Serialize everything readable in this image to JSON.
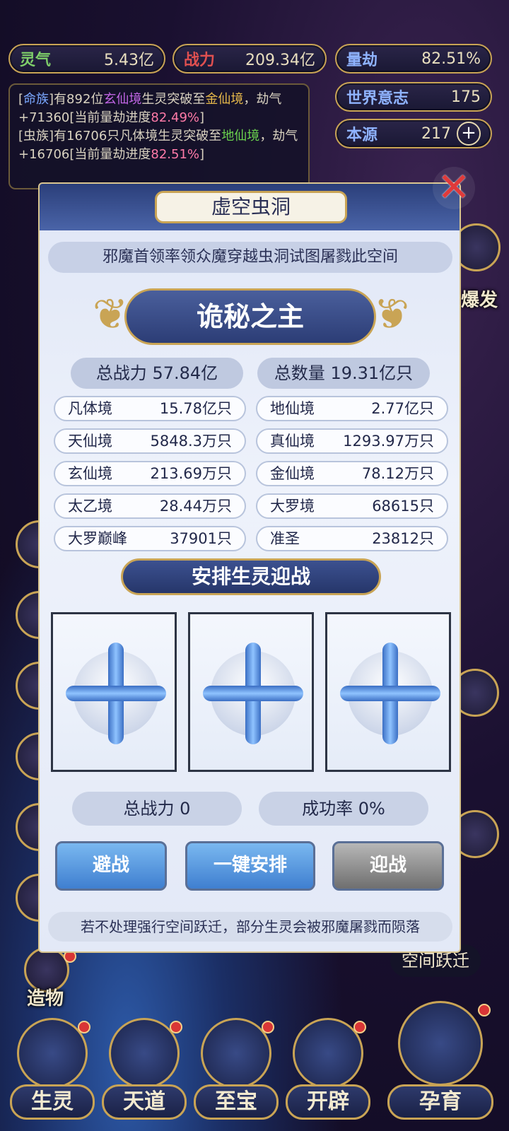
{
  "resources": {
    "lingqi": {
      "label": "灵气",
      "value": "5.43亿"
    },
    "zhanli": {
      "label": "战力",
      "value": "209.34亿"
    },
    "liangjie": {
      "label": "量劫",
      "value": "82.51%"
    },
    "shijie": {
      "label": "世界意志",
      "value": "175"
    },
    "benyuan": {
      "label": "本源",
      "value": "217",
      "plus": "+"
    }
  },
  "log": {
    "l1_a": "[",
    "l1_b": "命族",
    "l1_c": "]有892位",
    "l1_d": "玄仙境",
    "l1_e": "生灵突破至",
    "l1_f": "金仙境",
    "l1_g": "，劫气+71360[当前量劫进度",
    "l1_h": "82.49%",
    "l1_i": "]",
    "l2_a": "[虫族]有16706只凡体境生灵突破至",
    "l2_b": "地仙境",
    "l2_c": "，劫气+16706[当前量劫进度",
    "l2_d": "82.51%",
    "l2_e": "]"
  },
  "side": {
    "burst": "爆发",
    "create": "造物",
    "jump": "空间跃迁"
  },
  "bottom_nav": [
    {
      "label": "生灵"
    },
    {
      "label": "天道"
    },
    {
      "label": "至宝"
    },
    {
      "label": "开辟"
    },
    {
      "label": "孕育"
    }
  ],
  "modal": {
    "title": "虚空虫洞",
    "desc": "邪魔首领率领众魔穿越虫洞试图屠戮此空间",
    "boss": "诡秘之主",
    "total_power_label": "总战力",
    "total_power_value": "57.84亿",
    "total_count_label": "总数量",
    "total_count_value": "19.31亿只",
    "rows": [
      {
        "l_name": "凡体境",
        "l_val": "15.78亿只",
        "r_name": "地仙境",
        "r_val": "2.77亿只"
      },
      {
        "l_name": "天仙境",
        "l_val": "5848.3万只",
        "r_name": "真仙境",
        "r_val": "1293.97万只"
      },
      {
        "l_name": "玄仙境",
        "l_val": "213.69万只",
        "r_name": "金仙境",
        "r_val": "78.12万只"
      },
      {
        "l_name": "太乙境",
        "l_val": "28.44万只",
        "r_name": "大罗境",
        "r_val": "68615只"
      },
      {
        "l_name": "大罗巅峰",
        "l_val": "37901只",
        "r_name": "准圣",
        "r_val": "23812只"
      }
    ],
    "arrange": "安排生灵迎战",
    "sum_power": "总战力 0",
    "success": "成功率 0%",
    "btn_avoid": "避战",
    "btn_auto": "一键安排",
    "btn_fight": "迎战",
    "warning": "若不处理强行空间跃迁，部分生灵会被邪魔屠戮而陨落",
    "close": "✕"
  }
}
